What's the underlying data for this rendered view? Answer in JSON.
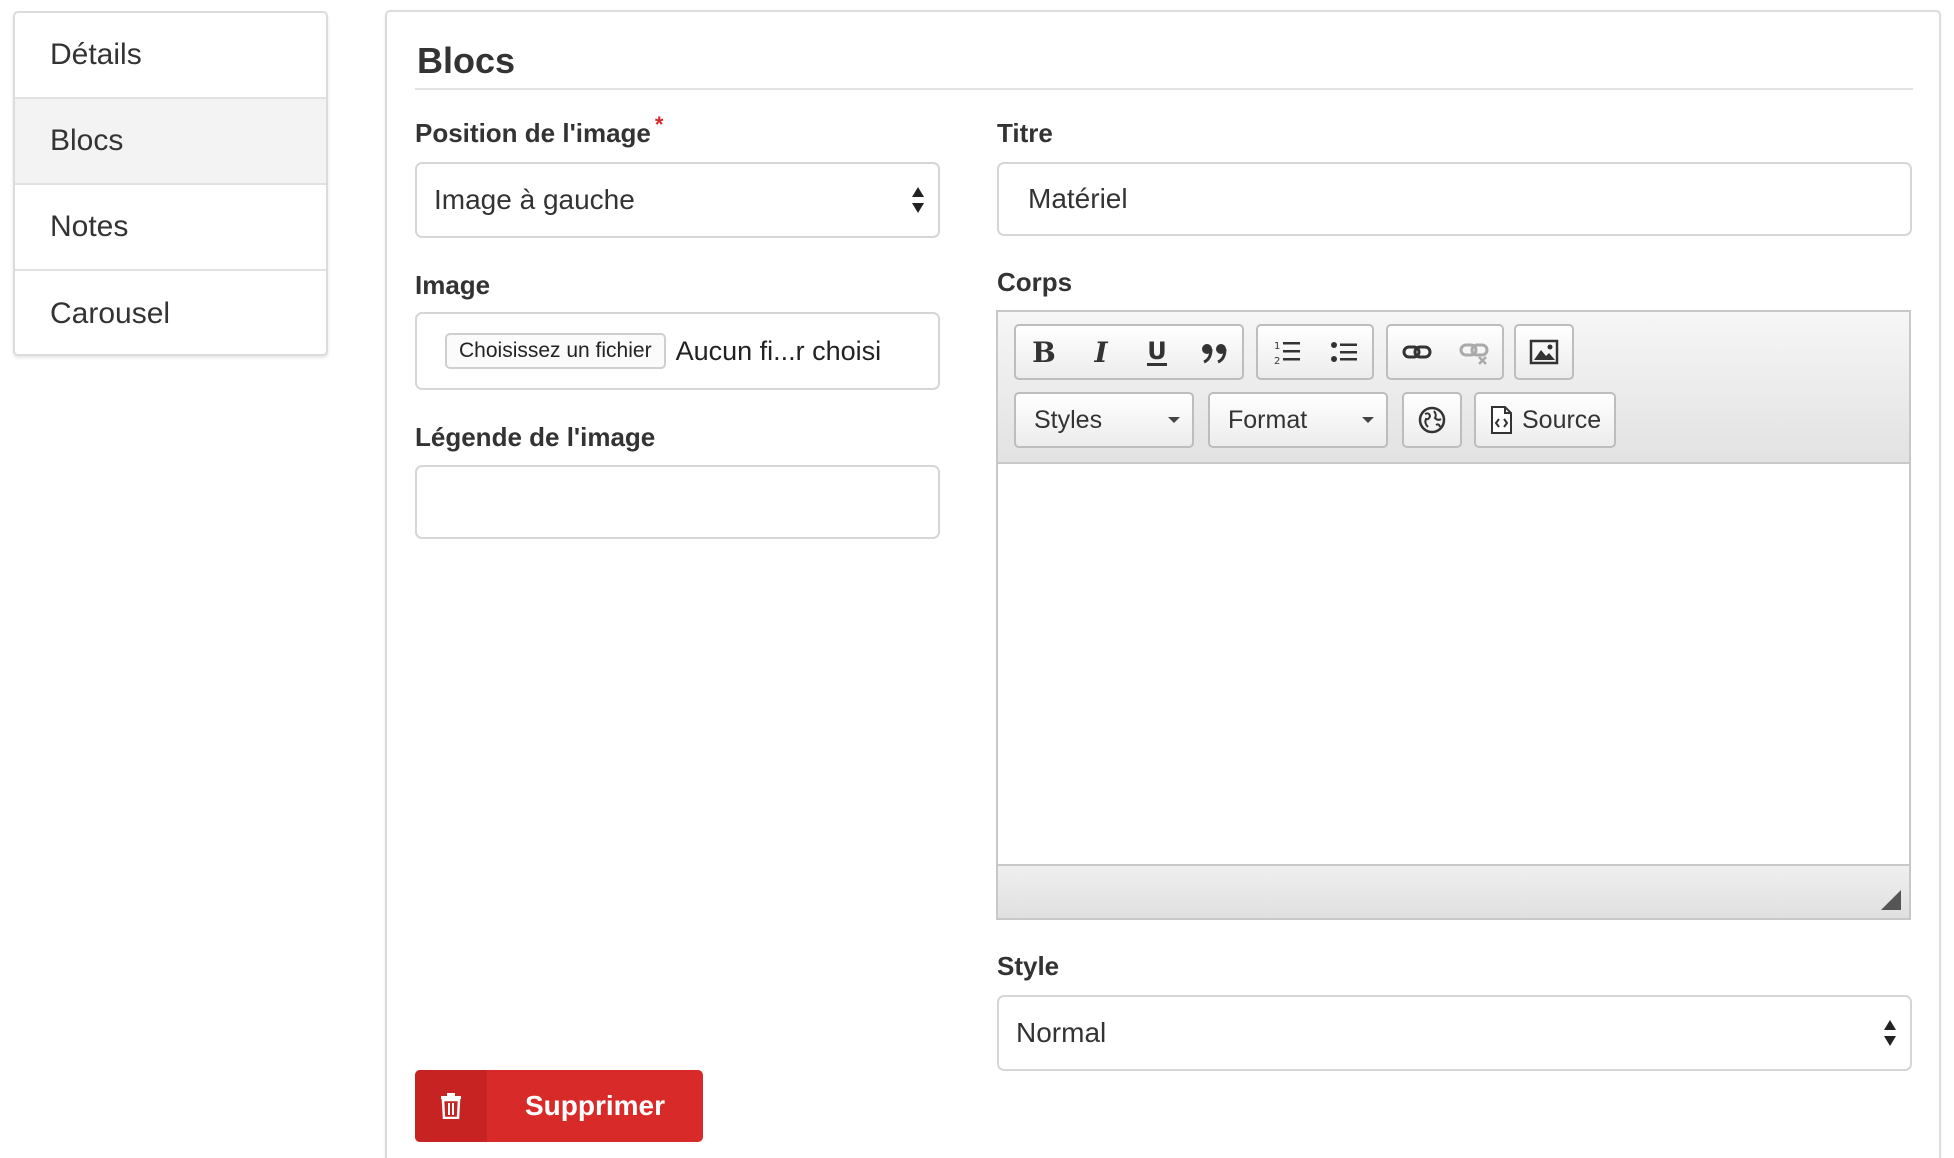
{
  "sidebar": {
    "items": [
      {
        "label": "Détails",
        "active": false
      },
      {
        "label": "Blocs",
        "active": true
      },
      {
        "label": "Notes",
        "active": false
      },
      {
        "label": "Carousel",
        "active": false
      }
    ]
  },
  "panel": {
    "title": "Blocs"
  },
  "form": {
    "image_position": {
      "label": "Position de l'image",
      "required_mark": "*",
      "value": "Image à gauche"
    },
    "image": {
      "label": "Image",
      "button_label": "Choisissez un fichier",
      "status": "Aucun fi...r choisi"
    },
    "caption": {
      "label": "Légende de l'image",
      "value": ""
    },
    "title": {
      "label": "Titre",
      "value": "Matériel"
    },
    "body": {
      "label": "Corps",
      "styles_label": "Styles",
      "format_label": "Format",
      "source_label": "Source",
      "toolbar_icons": [
        "bold-icon",
        "italic-icon",
        "underline-icon",
        "blockquote-icon",
        "numbered-list-icon",
        "bullet-list-icon",
        "link-icon",
        "unlink-icon",
        "image-icon",
        "globe-icon",
        "source-icon"
      ]
    },
    "style": {
      "label": "Style",
      "value": "Normal"
    }
  },
  "actions": {
    "delete_label": "Supprimer"
  },
  "colors": {
    "danger": "#d92a2a",
    "required": "#d62a2a",
    "border": "#d6d6d6"
  }
}
